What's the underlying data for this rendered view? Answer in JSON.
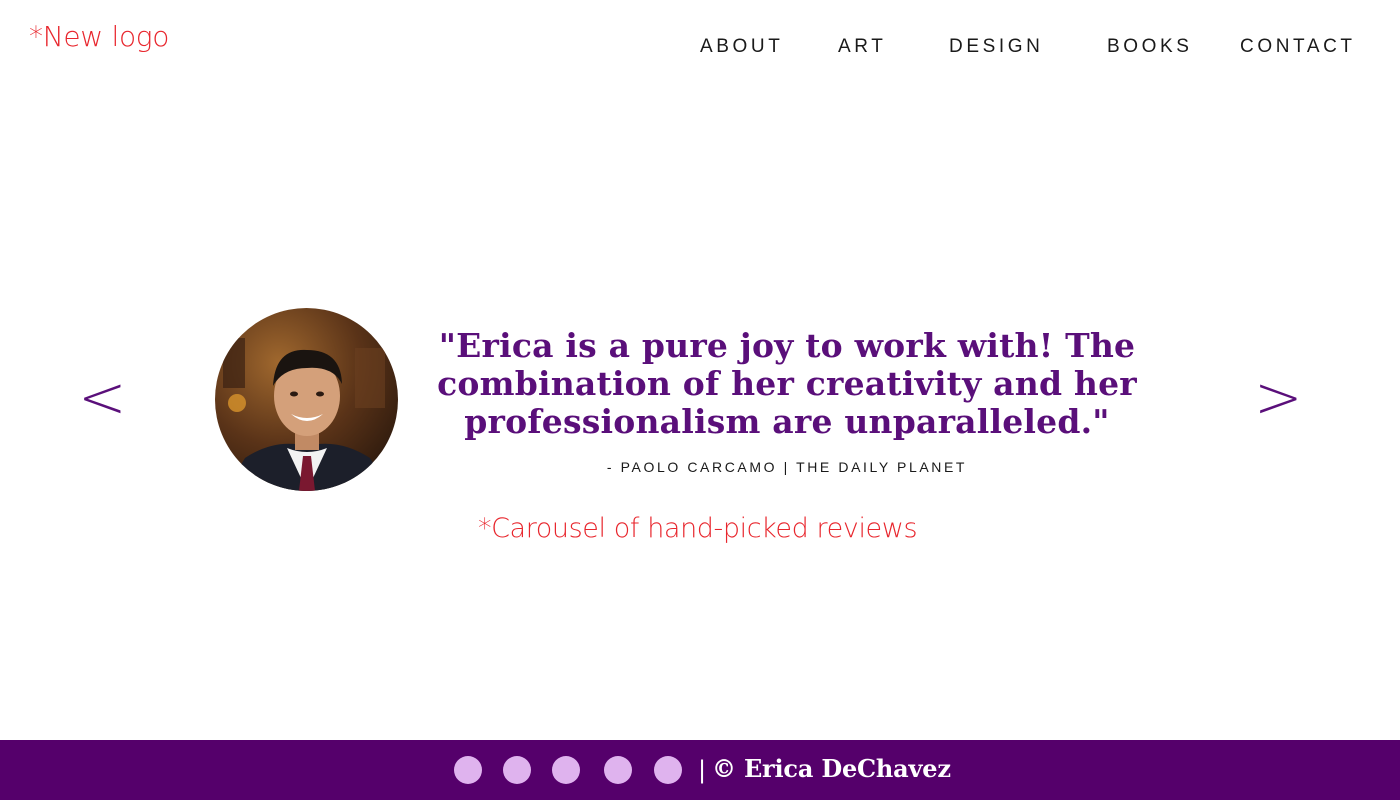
{
  "header": {
    "logo_text": "*New logo",
    "nav": {
      "about": "ABOUT",
      "art": "ART",
      "design": "DESIGN",
      "books": "BOOKS",
      "contact": "CONTACT"
    }
  },
  "carousel": {
    "prev_label": "<",
    "next_label": ">",
    "avatar_icon": "reviewer-photo",
    "quote": "\"Erica is a pure joy to work with! The combination of her creativity and her professionalism are unparalleled.\"",
    "attribution": "- PAOLO CARCAMO | THE DAILY PLANET",
    "note": "*Carousel of hand-picked reviews"
  },
  "footer": {
    "separator": "|",
    "copyright": "© Erica DeChavez",
    "social_icons": [
      "social-icon",
      "social-icon",
      "social-icon",
      "social-icon",
      "social-icon"
    ]
  },
  "colors": {
    "accent_purple": "#5a0f7a",
    "footer_purple": "#55006b",
    "note_red": "#e8262d",
    "dot_lavender": "#dfb3ee"
  }
}
